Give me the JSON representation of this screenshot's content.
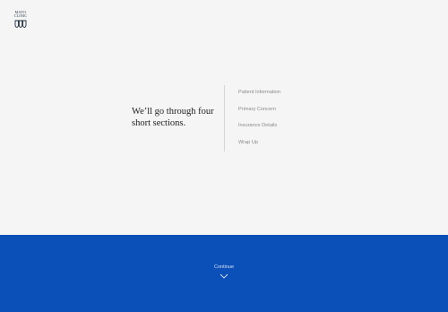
{
  "logo": {
    "line1": "MAYO",
    "line2": "CLINIC",
    "icon": "shield-icon"
  },
  "intro": {
    "heading": "We’ll go through four short sections."
  },
  "sections": [
    {
      "label": "Patient Information"
    },
    {
      "label": "Primary Concern"
    },
    {
      "label": "Insurance Details"
    },
    {
      "label": "Wrap Up"
    }
  ],
  "footer": {
    "continue_label": "Continue",
    "continue_icon": "chevron-down-icon"
  },
  "colors": {
    "background": "#f5f5f5",
    "footer_blue": "#0b4fb8"
  }
}
